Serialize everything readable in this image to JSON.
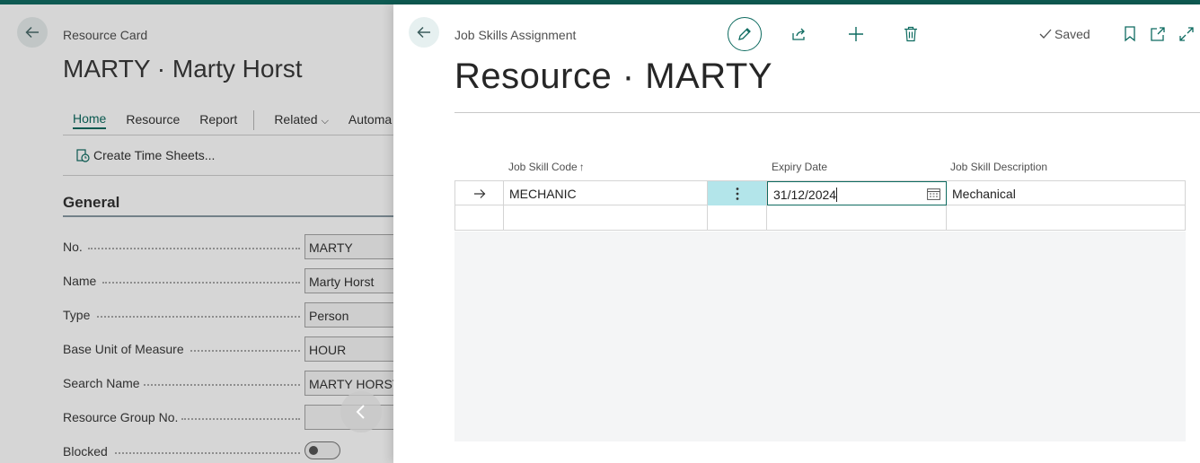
{
  "background_card": {
    "breadcrumb": "Resource Card",
    "title": "MARTY · Marty Horst",
    "tabs": [
      "Home",
      "Resource",
      "Report",
      "Related",
      "Automa"
    ],
    "active_tab": "Home",
    "action_label": "Create Time Sheets...",
    "section_title": "General",
    "fields": [
      {
        "label": "No.",
        "value": "MARTY"
      },
      {
        "label": "Name",
        "value": "Marty Horst"
      },
      {
        "label": "Type",
        "value": "Person"
      },
      {
        "label": "Base Unit of Measure",
        "value": "HOUR"
      },
      {
        "label": "Search Name",
        "value": "MARTY HORST"
      },
      {
        "label": "Resource Group No.",
        "value": ""
      },
      {
        "label": "Blocked",
        "value": ""
      }
    ],
    "blocked_toggle": "off"
  },
  "dialog": {
    "breadcrumb": "Job Skills Assignment",
    "status": "Saved",
    "title": "Resource · MARTY",
    "columns": {
      "job_skill_code": "Job Skill Code",
      "expiry_date": "Expiry Date",
      "job_skill_description": "Job Skill Description"
    },
    "sort_indicator": "↑",
    "rows": [
      {
        "job_skill_code": "MECHANIC",
        "expiry_date": "31/12/2024",
        "job_skill_description": "Mechanical"
      }
    ]
  },
  "colors": {
    "accent": "#0e6b60",
    "top_bar": "#0e5a52",
    "row_highlight": "#b3e5ea"
  },
  "icons": {
    "back": "arrow-left-icon",
    "edit": "pencil-icon",
    "share": "share-icon",
    "new": "plus-icon",
    "delete": "trash-icon",
    "bookmark": "bookmark-icon",
    "open_new": "open-in-new-window-icon",
    "expand": "expand-icon",
    "calendar": "calendar-icon",
    "row_menu": "more-vertical-icon",
    "row_selected": "arrow-right-icon",
    "collapse": "chevron-left-icon"
  }
}
